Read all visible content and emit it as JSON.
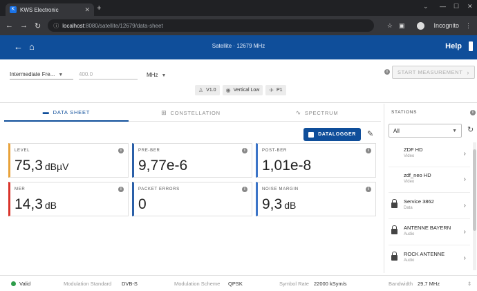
{
  "browser": {
    "tab_title": "KWS Electronic",
    "url_host": "localhost",
    "url_path": ":8080/satellite/12679/data-sheet",
    "profile_label": "Incognito"
  },
  "header": {
    "subtitle": "Satellite  ·  12679 MHz",
    "help_label": "Help"
  },
  "controls": {
    "mode_select": "Intermediate Fre...",
    "freq_placeholder": "400.0",
    "unit_select": "MHz",
    "start_label": "START MEASUREMENT",
    "chips": [
      {
        "label": "V1.0",
        "icon": "dish-icon"
      },
      {
        "label": "Vertical Low",
        "icon": "polarization-icon"
      },
      {
        "label": "P1",
        "icon": "satellite-icon"
      }
    ]
  },
  "tabs": [
    {
      "label": "DATA SHEET",
      "icon": "▬"
    },
    {
      "label": "CONSTELLATION",
      "icon": "⊞"
    },
    {
      "label": "SPECTRUM",
      "icon": "∿"
    }
  ],
  "datalogger_label": "DATALOGGER",
  "cards": [
    {
      "label": "LEVEL",
      "value": "75,3",
      "unit": "dBµV"
    },
    {
      "label": "PRE-BER",
      "value": "9,77e-6",
      "unit": ""
    },
    {
      "label": "POST-BER",
      "value": "1,01e-8",
      "unit": ""
    },
    {
      "label": "MER",
      "value": "14,3",
      "unit": "dB"
    },
    {
      "label": "PACKET ERRORS",
      "value": "0",
      "unit": ""
    },
    {
      "label": "NOISE MARGIN",
      "value": "9,3",
      "unit": "dB"
    }
  ],
  "stations": {
    "title": "STATIONS",
    "filter": "All",
    "items": [
      {
        "name": "ZDF HD",
        "type": "Video",
        "locked": false
      },
      {
        "name": "zdf_neo HD",
        "type": "Video",
        "locked": false
      },
      {
        "name": "Service 3862",
        "type": "Data",
        "locked": true
      },
      {
        "name": "ANTENNE BAYERN",
        "type": "Audio",
        "locked": true
      },
      {
        "name": "ROCK ANTENNE",
        "type": "Audio",
        "locked": true
      }
    ]
  },
  "status": {
    "valid": "Valid",
    "mod_std_label": "Modulation Standard",
    "mod_std_value": "DVB-S",
    "mod_scheme_label": "Modulation Scheme",
    "mod_scheme_value": "QPSK",
    "symbol_label": "Symbol Rate",
    "symbol_value": "22000 kSym/s",
    "bandwidth_label": "Bandwidth",
    "bandwidth_value": "29,7 MHz"
  },
  "colors": {
    "brand": "#0f4e9a",
    "valid": "#2e9d4a",
    "level_accent": "#e8a23a",
    "mer_accent": "#d9342b"
  }
}
